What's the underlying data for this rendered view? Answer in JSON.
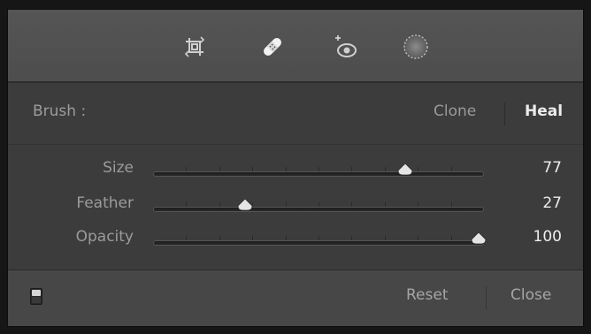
{
  "tools": [
    {
      "icon": "crop-overlay-icon"
    },
    {
      "icon": "spot-removal-icon"
    },
    {
      "icon": "red-eye-correction-icon"
    },
    {
      "icon": "graduated-filter-icon"
    }
  ],
  "brush": {
    "label": "Brush :",
    "modes": [
      "Clone",
      "Heal"
    ],
    "selected_mode": "Heal"
  },
  "sliders": [
    {
      "label": "Size",
      "value": "77",
      "level": 77
    },
    {
      "label": "Feather",
      "value": "27",
      "level": 27
    },
    {
      "label": "Opacity",
      "value": "100",
      "level": 100
    }
  ],
  "footer": {
    "reset_label": "Reset",
    "close_label": "Close"
  },
  "colors": {
    "panel": "#4a4a4a",
    "content": "#3c3c3c",
    "active_text": "#ececec",
    "inactive_text": "#9a9a9a"
  }
}
